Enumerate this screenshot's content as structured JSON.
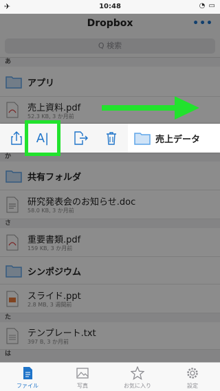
{
  "status": {
    "time": "10:48",
    "signal": "✈",
    "battery": "◔ ▭"
  },
  "nav": {
    "title": "Dropbox",
    "more": "•••"
  },
  "search": {
    "placeholder": "Q 検索"
  },
  "sections": [
    {
      "key": "a",
      "label": "あ"
    },
    {
      "key": "ka",
      "label": "か"
    },
    {
      "key": "sa",
      "label": "さ"
    },
    {
      "key": "ta",
      "label": "た"
    },
    {
      "key": "ha",
      "label": "は"
    }
  ],
  "rows": [
    {
      "name": "アプリ",
      "type": "folder"
    },
    {
      "name": "売上資料.pdf",
      "meta": "52.3 KB, 3 か月前",
      "type": "pdf"
    },
    {
      "name": "共有フォルダ",
      "type": "folder"
    },
    {
      "name": "研究発表会のお知らせ.doc",
      "meta": "58.0 KB, 3 か月前",
      "type": "doc"
    },
    {
      "name": "重要書類.pdf",
      "meta": "159 KB, 3 か月前",
      "type": "pdf"
    },
    {
      "name": "シンポジウム",
      "type": "folder"
    },
    {
      "name": "スライド.ppt",
      "meta": "2.8 MB, 3 週間前",
      "type": "ppt"
    },
    {
      "name": "テンプレート.txt",
      "meta": "397 B, 3 か月前",
      "type": "txt"
    }
  ],
  "action_row": {
    "name": "売上データ",
    "rename_label": "A|"
  },
  "tabs": [
    {
      "label": "ファイル",
      "active": true
    },
    {
      "label": "写真",
      "active": false
    },
    {
      "label": "お気に入り",
      "active": false
    },
    {
      "label": "設定",
      "active": false
    }
  ],
  "colors": {
    "accent": "#1f74c9",
    "highlight": "#22e22d",
    "folder": "#5fa5e8"
  },
  "icons": {
    "share": "share-icon",
    "rename": "rename-icon",
    "move": "move-icon",
    "delete": "trash-icon",
    "folder": "folder-icon",
    "arrow": "right-arrow-icon"
  }
}
